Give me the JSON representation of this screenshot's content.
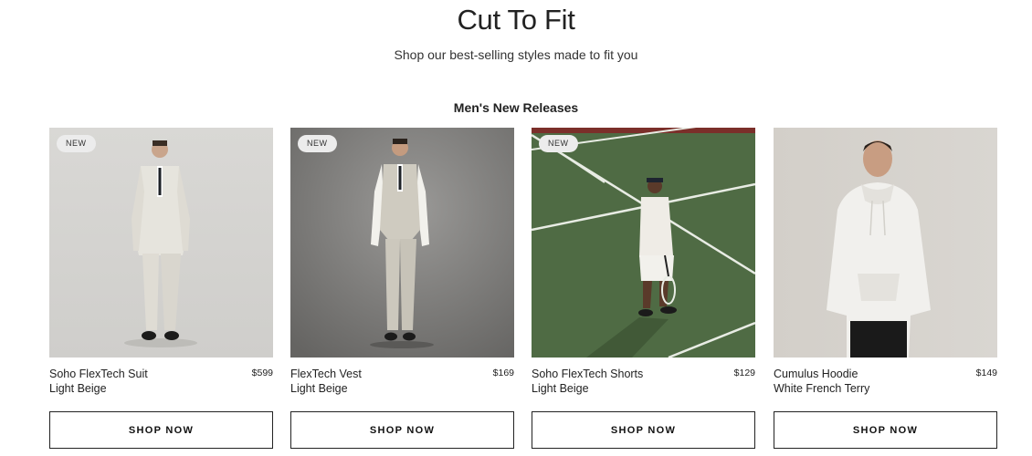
{
  "page": {
    "title": "Cut To Fit",
    "subtitle": "Shop our best-selling styles made to fit you",
    "section_heading": "Men's New Releases"
  },
  "products": [
    {
      "badge": "NEW",
      "name": "Soho FlexTech Suit",
      "variant": "Light Beige",
      "price": "$599",
      "cta": "SHOP NOW",
      "image_icon": "suit-model-photo"
    },
    {
      "badge": "NEW",
      "name": "FlexTech Vest",
      "variant": "Light Beige",
      "price": "$169",
      "cta": "SHOP NOW",
      "image_icon": "vest-model-photo"
    },
    {
      "badge": "NEW",
      "name": "Soho FlexTech Shorts",
      "variant": "Light Beige",
      "price": "$129",
      "cta": "SHOP NOW",
      "image_icon": "tennis-court-model-photo"
    },
    {
      "badge": "",
      "name": "Cumulus Hoodie",
      "variant": "White French Terry",
      "price": "$149",
      "cta": "SHOP NOW",
      "image_icon": "hoodie-model-photo"
    }
  ],
  "colors": {
    "court_green": "#4f6b44",
    "court_line": "#e8ece4",
    "studio_gray": "#d5d4d1",
    "studio_dark": "#7a7a78",
    "badge_bg": "#ececec"
  }
}
